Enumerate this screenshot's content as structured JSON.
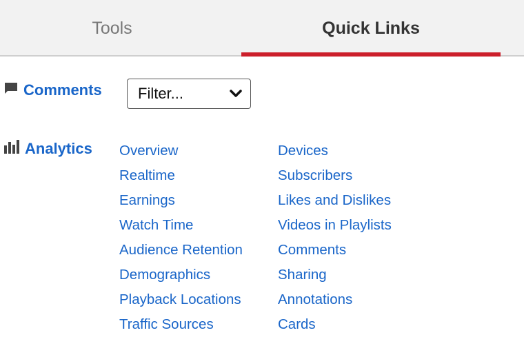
{
  "tabs": [
    {
      "label": "Tools",
      "active": false
    },
    {
      "label": "Quick Links",
      "active": true
    }
  ],
  "colors": {
    "accent_red": "#cc1f2b",
    "link_blue": "#1a66c9",
    "tabbar_bg": "#f2f2f2",
    "icon_gray": "#444444"
  },
  "comments": {
    "icon": "comment-bubble-icon",
    "label": "Comments",
    "filter": {
      "selected": "Filter...",
      "icon": "chevron-down-icon"
    }
  },
  "analytics": {
    "icon": "bar-chart-icon",
    "label": "Analytics",
    "columns": [
      [
        "Overview",
        "Realtime",
        "Earnings",
        "Watch Time",
        "Audience Retention",
        "Demographics",
        "Playback Locations",
        "Traffic Sources"
      ],
      [
        "Devices",
        "Subscribers",
        "Likes and Dislikes",
        "Videos in Playlists",
        "Comments",
        "Sharing",
        "Annotations",
        "Cards"
      ]
    ]
  }
}
